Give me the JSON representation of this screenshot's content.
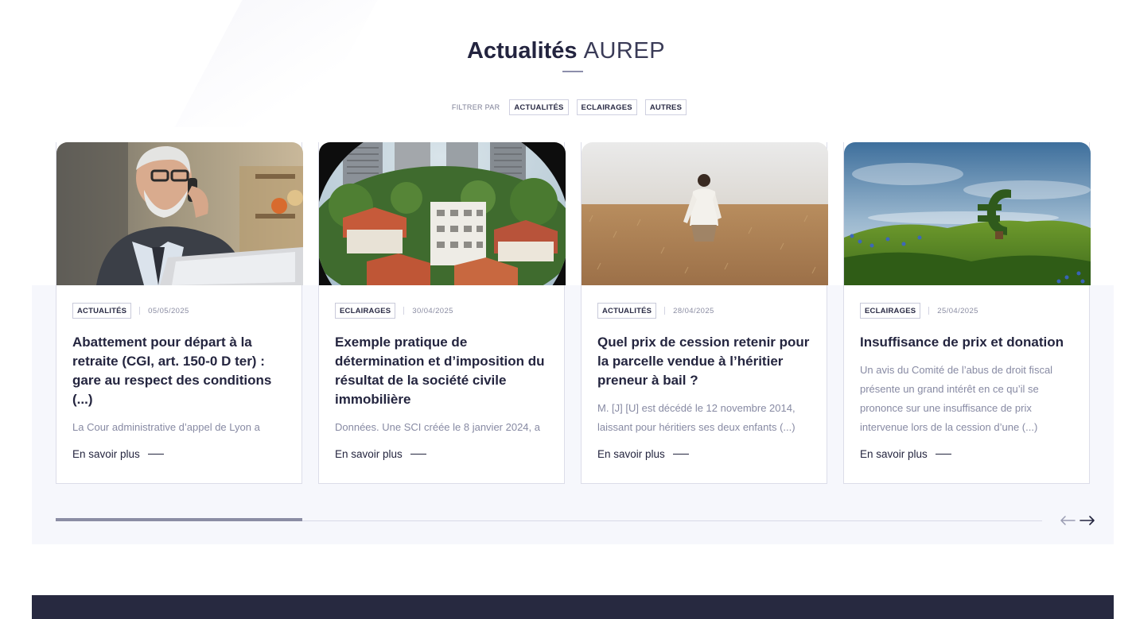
{
  "section": {
    "title_strong": "Actualités",
    "title_light": "AUREP"
  },
  "filters": {
    "label": "FILTRER PAR",
    "options": [
      "ACTUALITÉS",
      "ECLAIRAGES",
      "AUTRES"
    ]
  },
  "cards": [
    {
      "tag": "ACTUALITÉS",
      "date": "05/05/2025",
      "title": "Abattement pour départ à la retraite (CGI, art. 150-0 D ter) : gare au respect des conditions (...)",
      "excerpt": "La Cour administrative d’appel de Lyon a",
      "read_more": "En savoir plus"
    },
    {
      "tag": "ECLAIRAGES",
      "date": "30/04/2025",
      "title": "Exemple pratique de détermination et d’imposition du résultat de la société civile immobilière",
      "excerpt": "Données. Une SCI créée le 8 janvier 2024, a",
      "read_more": "En savoir plus"
    },
    {
      "tag": "ACTUALITÉS",
      "date": "28/04/2025",
      "title": "Quel prix de cession retenir pour la parcelle vendue à l’héritier preneur à bail ?",
      "excerpt": "M. [J] [U] est décédé le 12 novembre 2014, laissant pour héritiers ses deux enfants (...)",
      "read_more": "En savoir plus"
    },
    {
      "tag": "ECLAIRAGES",
      "date": "25/04/2025",
      "title": "Insuffisance de prix et donation",
      "excerpt": "Un avis du Comité de l’abus de droit fiscal présente un grand intérêt en ce qu’il se prononce sur une insuffisance de prix intervenue lors de la cession d’une (...)",
      "read_more": "En savoir plus"
    }
  ],
  "carousel": {
    "progress": 0.25,
    "prev_icon": "arrow-left-icon",
    "next_icon": "arrow-right-icon"
  },
  "colors": {
    "dark": "#24253f",
    "band": "#f6f7fc",
    "footer": "#272940",
    "muted": "#878aa3"
  }
}
